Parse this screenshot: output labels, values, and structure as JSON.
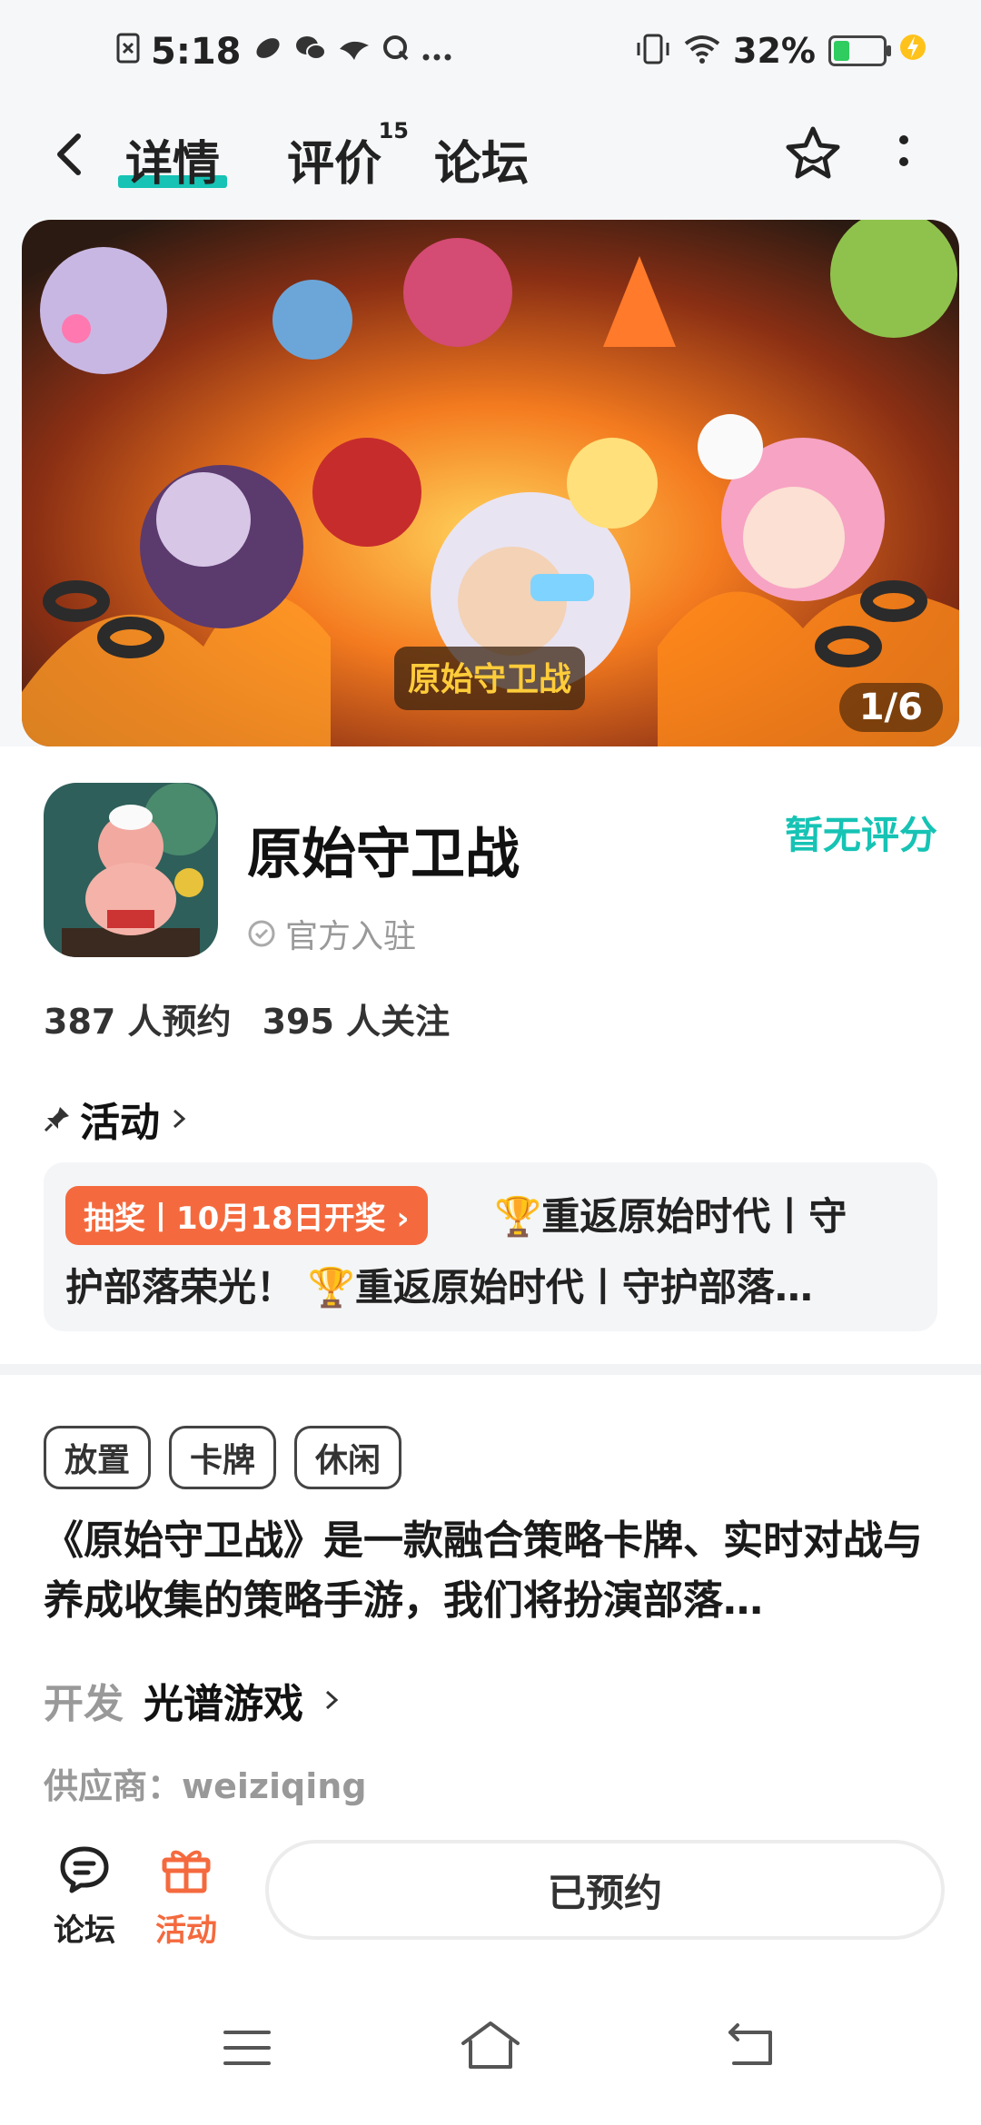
{
  "status_bar": {
    "time": "5:18",
    "battery_percent": "32%",
    "battery_level": 0.32,
    "left_icons": [
      "sim-error-icon",
      "link-icon",
      "wechat-icon",
      "bird-icon",
      "search-q-icon",
      "more-dots"
    ],
    "right_icons": [
      "vibrate-icon",
      "wifi-icon",
      "battery-icon",
      "charging-bolt-icon"
    ]
  },
  "nav": {
    "tabs": [
      {
        "label": "详情",
        "active": true
      },
      {
        "label": "评价",
        "badge": "15"
      },
      {
        "label": "论坛"
      }
    ]
  },
  "banner": {
    "counter": "1/6",
    "logo_text": "原始守卫战"
  },
  "app": {
    "name": "原始守卫战",
    "official_label": "官方入驻",
    "rating_text": "暂无评分",
    "stats": {
      "reservations": "387 人预约",
      "followers": "395 人关注"
    }
  },
  "activity": {
    "heading": "活动",
    "badge": "抽奖丨10月18日开奖",
    "line1": "🏆重返原始时代丨守",
    "line2": "护部落荣光！ 🏆重返原始时代丨守护部落…"
  },
  "details": {
    "tags": [
      "放置",
      "卡牌",
      "休闲"
    ],
    "description": "《原始守卫战》是一款融合策略卡牌、实时对战与养成收集的策略手游，我们将扮演部落…",
    "developer_label": "开发",
    "developer_value": "光谱游戏",
    "supplier": "供应商：weiziqing"
  },
  "action_bar": {
    "forum_label": "论坛",
    "event_label": "活动",
    "reserved_button": "已预约"
  },
  "colors": {
    "accent": "#16c3b4",
    "orange": "#f46a3e"
  }
}
